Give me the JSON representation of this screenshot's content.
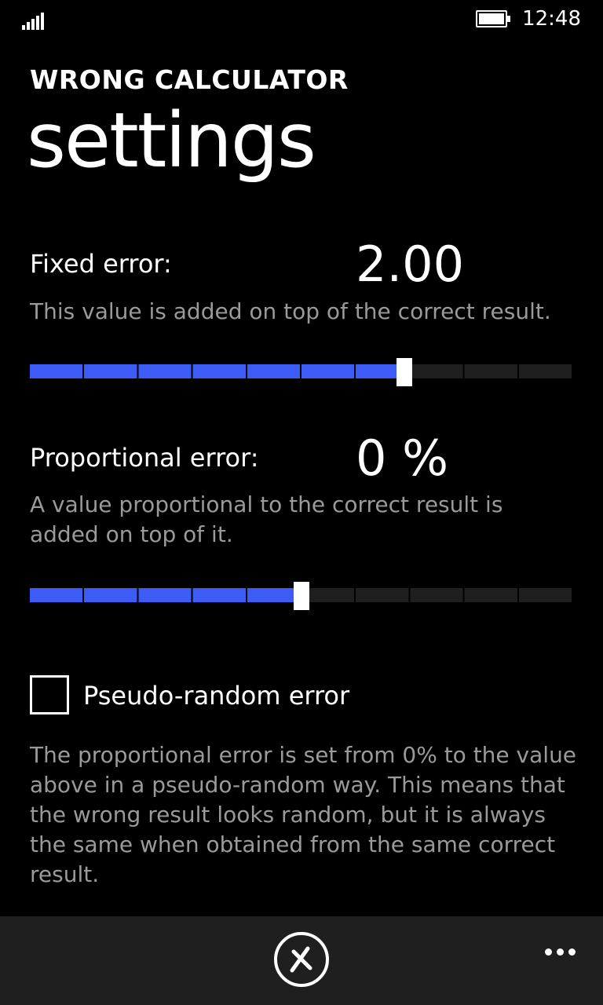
{
  "status_bar": {
    "time": "12:48",
    "signal_icon": "signal-bars-icon",
    "battery_icon": "battery-icon",
    "battery_level": 1.0
  },
  "header": {
    "app_title": "WRONG CALCULATOR",
    "page_title": "settings"
  },
  "fixed_error": {
    "label": "Fixed error:",
    "value": "2.00",
    "description": "This value is added on top of the correct result.",
    "slider_level": 0.69
  },
  "proportional_error": {
    "label": "Proportional error:",
    "value": "0 %",
    "description": "A value proportional to the correct result is added on top of it.",
    "slider_level": 0.5
  },
  "pseudo_random": {
    "label": "Pseudo-random error",
    "checked": false,
    "description": "The proportional error is set from 0% to the value above in a pseudo-random way. This means that the wrong result looks random, but it is always the same when obtained from the same correct result."
  },
  "app_bar": {
    "cancel_icon": "cancel-icon",
    "more_icon": "more-dots-icon"
  },
  "colors": {
    "accent": "#3d5cf5",
    "background": "#000000",
    "app_bar": "#1f1f1f",
    "secondary_text": "#9a9a9a"
  }
}
